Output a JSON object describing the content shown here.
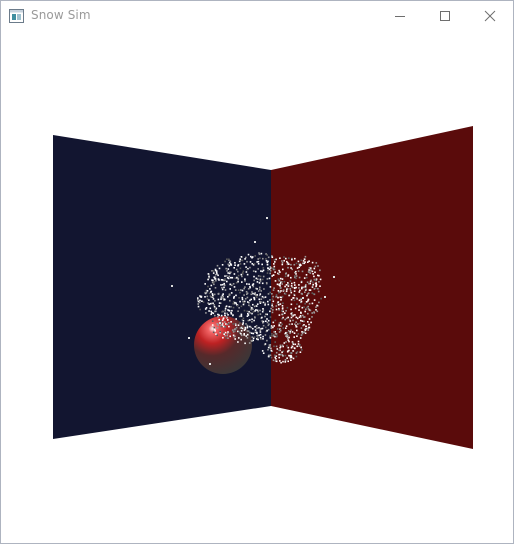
{
  "window": {
    "title": "Snow Sim",
    "icon": "app-window-icon"
  },
  "titlebar_buttons": [
    {
      "name": "minimize",
      "icon": "minimize-icon"
    },
    {
      "name": "maximize",
      "icon": "maximize-icon"
    },
    {
      "name": "close",
      "icon": "close-icon"
    }
  ],
  "scene": {
    "left_wall_color": "#121530",
    "right_wall_color": "#5a0b0b",
    "background_color": "#ffffff",
    "sphere_color": "#d42828",
    "snow_color": "#ffffff"
  }
}
